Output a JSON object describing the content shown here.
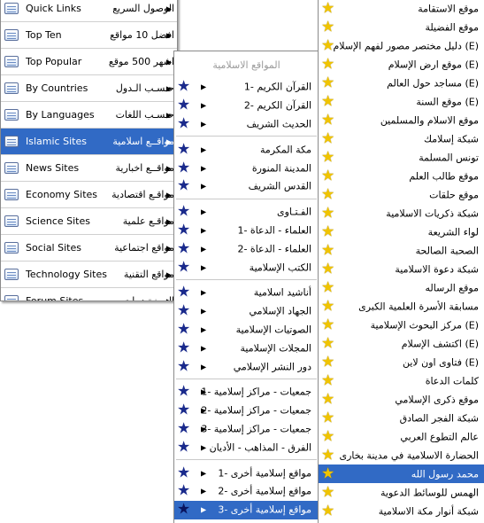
{
  "menu1": {
    "items": [
      {
        "en": "Quick Links",
        "ar": "الوصول السريع",
        "icon": "list-icon",
        "arrow": "▶"
      },
      {
        "en": "Top Ten",
        "ar": "افضل 10 مواقع",
        "icon": "table-icon",
        "arrow": "▶"
      },
      {
        "en": "Top Popular",
        "ar": "اشهر 500 موقع",
        "icon": "table-icon",
        "arrow": "▶"
      },
      {
        "en": "By Countries",
        "ar": "حـسـب الـدول",
        "icon": "window-icon",
        "arrow": "▶"
      },
      {
        "en": "By Languages",
        "ar": "حـسـب اللغات",
        "icon": "window-icon",
        "arrow": "▶"
      },
      {
        "en": "Islamic Sites",
        "ar": "مواقــع اسلامية",
        "icon": "islamic-sites-icon",
        "arrow": "▶"
      },
      {
        "en": "News Sites",
        "ar": "مواقــع اخبارية",
        "icon": "news-icon",
        "arrow": "▶"
      },
      {
        "en": "Economy Sites",
        "ar": "مواقـع اقتصادية",
        "icon": "economy-icon",
        "arrow": "▶"
      },
      {
        "en": "Science Sites",
        "ar": "مواقـع علمية",
        "icon": "science-icon",
        "arrow": "▶"
      },
      {
        "en": "Social Sites",
        "ar": "مواقع اجتماعية",
        "icon": "social-icon",
        "arrow": "▶"
      },
      {
        "en": "Technology Sites",
        "ar": "مواقع التقنية",
        "icon": "technology-icon",
        "arrow": "▶"
      },
      {
        "en": "Forum Sites",
        "ar": "الـمـنـتـديـات",
        "icon": "forum-icon",
        "arrow": "▶"
      }
    ]
  },
  "menu2": {
    "title": "المواقع الاسلامية",
    "groups": [
      [
        {
          "label": "القرآن الكريم -1",
          "arrow": "▶"
        },
        {
          "label": "القرآن الكريم -2",
          "arrow": "▶"
        },
        {
          "label": "الحديث الشريف",
          "arrow": "▶"
        }
      ],
      [
        {
          "label": "مكة المكرمة",
          "arrow": "▶"
        },
        {
          "label": "المدينة المنورة",
          "arrow": "▶"
        },
        {
          "label": "القدس الشريف",
          "arrow": "▶"
        }
      ],
      [
        {
          "label": "الفـتـاوى",
          "arrow": "▶"
        },
        {
          "label": "العلماء - الدعاة -1",
          "arrow": "▶"
        },
        {
          "label": "العلماء - الدعاة -2",
          "arrow": "▶"
        },
        {
          "label": "الكتب الإسلامية",
          "arrow": "▶"
        }
      ],
      [
        {
          "label": "أناشيد اسلامية",
          "arrow": "▶"
        },
        {
          "label": "الجهاد الإسلامي",
          "arrow": "▶"
        },
        {
          "label": "الصوتيات الإسلامية",
          "arrow": "▶"
        },
        {
          "label": "المجلات الإسلامية",
          "arrow": "▶"
        },
        {
          "label": "دور النشر الإسلامي",
          "arrow": "▶"
        }
      ],
      [
        {
          "label": "جمعيات - مراكز إسلامية -1",
          "arrow": "▶"
        },
        {
          "label": "جمعيات - مراكز إسلامية -2",
          "arrow": "▶"
        },
        {
          "label": "جمعيات - مراكز إسلامية -3",
          "arrow": "▶"
        },
        {
          "label": "الفرق - المذاهب - الأديان",
          "arrow": "▶"
        }
      ],
      [
        {
          "label": "مواقع إسلامية أخرى -1",
          "arrow": "▶"
        },
        {
          "label": "مواقع إسلامية أخرى -2",
          "arrow": "▶"
        },
        {
          "label": "مواقع إسلامية أخرى -3",
          "arrow": "▶"
        }
      ]
    ]
  },
  "menu3": {
    "items": [
      "موقع الاستقامة",
      "موقع الفضيلة",
      "(E) دليل مختصر مصور لفهم الإسلام",
      "(E) موقع ارض الإسلام",
      "(E) مساجد حول العالم",
      "(E) موقع السنة",
      "موقع الاسلام والمسلمين",
      "شبكة إسلامك",
      "تونس المسلمة",
      "موقع طالب العلم",
      "موقع حلقات",
      "شبكة ذكريات الاسلامية",
      "لواء الشريعة",
      "الصحبة الصالحة",
      "شبكة دعوة الاسلامية",
      "موقع الرساله",
      "مسابقة الأسرة العلمية الكبرى",
      "(E) مركز البحوث الإسلامية",
      "(E) اكتشف الإسلام",
      "(E) فتاوى اون لاين",
      "كلمات الدعاة",
      "موقع ذكرى الإسلامي",
      "شبكة الفجر الصادق",
      "عالم التطوع العربي",
      "الحضارة الاسلامية في مدينة بخارى",
      "محمد رسول الله",
      "الهمس للوسائط الدعوية",
      "شبكة أنوار مكة الاسلامية"
    ]
  },
  "colors": {
    "highlight": "#316ac5",
    "star_blue": "#1a2a8c",
    "star_gold": "#f0c400"
  }
}
